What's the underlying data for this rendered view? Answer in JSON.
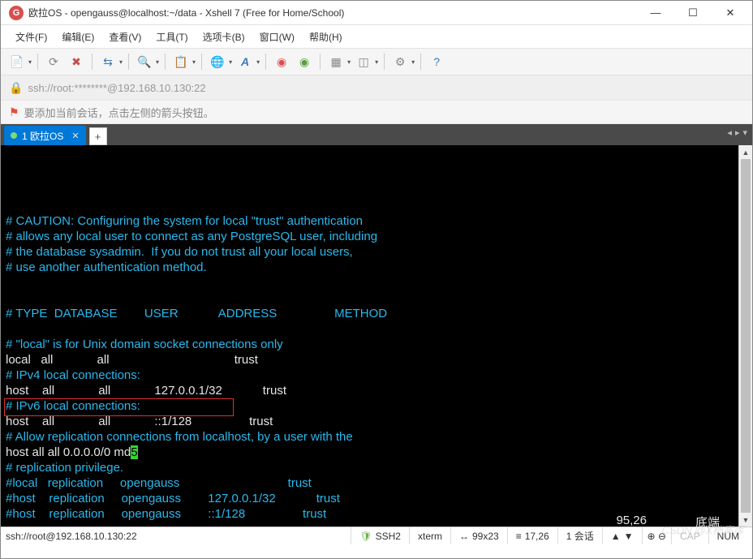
{
  "window": {
    "title": "欧拉OS - opengauss@localhost:~/data - Xshell 7 (Free for Home/School)",
    "icon_letter": "G"
  },
  "menu": {
    "items": [
      "文件(F)",
      "编辑(E)",
      "查看(V)",
      "工具(T)",
      "选项卡(B)",
      "窗口(W)",
      "帮助(H)"
    ]
  },
  "address": {
    "url": "ssh://root:********@192.168.10.130:22"
  },
  "infobar": {
    "text": "要添加当前会话，点击左侧的箭头按钮。"
  },
  "tabs": {
    "active": "1 欧拉OS"
  },
  "terminal": {
    "lines": [
      {
        "t": "",
        "c": "c"
      },
      {
        "t": "# CAUTION: Configuring the system for local \"trust\" authentication",
        "c": "c"
      },
      {
        "t": "# allows any local user to connect as any PostgreSQL user, including",
        "c": "c"
      },
      {
        "t": "# the database sysadmin.  If you do not trust all your local users,",
        "c": "c"
      },
      {
        "t": "# use another authentication method.",
        "c": "c"
      },
      {
        "t": "",
        "c": "c"
      },
      {
        "t": "",
        "c": "c"
      },
      {
        "t": "# TYPE  DATABASE        USER            ADDRESS                 METHOD",
        "c": "c"
      },
      {
        "t": "",
        "c": "c"
      },
      {
        "t": "# \"local\" is for Unix domain socket connections only",
        "c": "c"
      },
      {
        "t": "local   all             all                                     trust",
        "c": "w"
      },
      {
        "t": "# IPv4 local connections:",
        "c": "c"
      },
      {
        "t": "host    all             all             127.0.0.1/32            trust",
        "c": "w"
      },
      {
        "t": "# IPv6 local connections:",
        "c": "c"
      },
      {
        "t": "host    all             all             ::1/128                 trust",
        "c": "w"
      },
      {
        "t": "# Allow replication connections from localhost, by a user with the",
        "c": "c"
      },
      {
        "t": "host all all 0.0.0.0/0 md",
        "c": "w",
        "cursor": "5"
      },
      {
        "t": "# replication privilege.",
        "c": "c"
      },
      {
        "t": "#local   replication     opengauss                                trust",
        "c": "c"
      },
      {
        "t": "#host    replication     opengauss        127.0.0.1/32            trust",
        "c": "c"
      },
      {
        "t": "#host    replication     opengauss        ::1/128                 trust",
        "c": "c"
      },
      {
        "t": "~",
        "c": "c"
      }
    ],
    "pos": "95,26",
    "mode": "底端"
  },
  "status": {
    "conn": "ssh://root@192.168.10.130:22",
    "proto": "SSH2",
    "term": "xterm",
    "size": "99x23",
    "cursor": "17,26",
    "sessions": "1 会话",
    "cap": "CAP",
    "num": "NUM"
  },
  "watermark": "CSDN @X档案库"
}
